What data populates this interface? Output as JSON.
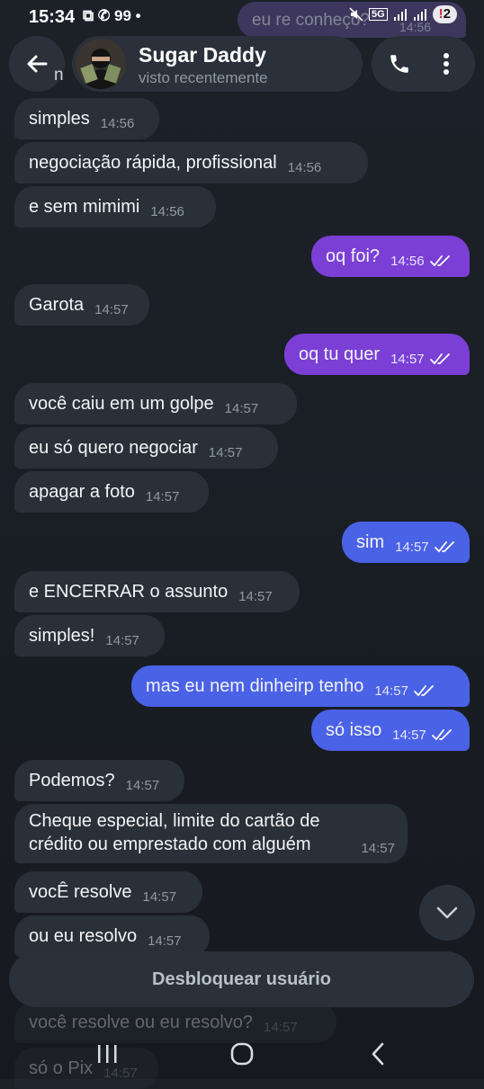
{
  "status_bar": {
    "time": "15:34",
    "left_icons": "⧉ ✆ 99 •",
    "network": "5G",
    "badge": "2"
  },
  "header": {
    "contact_name": "Sugar Daddy",
    "status": "visto recentemente",
    "peek_text": "n"
  },
  "top_partial": {
    "text": "eu re conheço?",
    "time": "14:56"
  },
  "messages": [
    {
      "dir": "in",
      "text": "simples",
      "time": "14:56"
    },
    {
      "dir": "in",
      "text": "negociação rápida, profissional",
      "time": "14:56"
    },
    {
      "dir": "in",
      "text": "e sem mimimi",
      "time": "14:56"
    },
    {
      "dir": "out",
      "text": "oq foi?",
      "time": "14:56"
    },
    {
      "dir": "in",
      "text": "Garota",
      "time": "14:57"
    },
    {
      "dir": "out",
      "text": "oq tu quer",
      "time": "14:57"
    },
    {
      "dir": "in",
      "text": "você caiu em um golpe",
      "time": "14:57"
    },
    {
      "dir": "in",
      "text": "eu só quero negociar",
      "time": "14:57"
    },
    {
      "dir": "in",
      "text": "apagar a foto",
      "time": "14:57"
    },
    {
      "dir": "out",
      "text": "sim",
      "time": "14:57"
    },
    {
      "dir": "in",
      "text": "e ENCERRAR o assunto",
      "time": "14:57"
    },
    {
      "dir": "in",
      "text": "simples!",
      "time": "14:57"
    },
    {
      "dir": "out",
      "text": "mas eu nem dinheirp tenho",
      "time": "14:57"
    },
    {
      "dir": "out",
      "text": "só isso",
      "time": "14:57"
    },
    {
      "dir": "in",
      "text": "Podemos?",
      "time": "14:57"
    },
    {
      "dir": "in",
      "text": "Cheque especial, limite do cartão de crédito ou emprestado com alguém",
      "time": "14:57"
    },
    {
      "dir": "in",
      "text": "vocÊ resolve",
      "time": "14:57"
    },
    {
      "dir": "in",
      "text": "ou eu resolvo",
      "time": "14:57"
    },
    {
      "dir": "in",
      "text": "você resolve ou eu resolvo?",
      "time": "14:57"
    },
    {
      "dir": "in",
      "text": "só o Pix",
      "time": "14:57"
    }
  ],
  "unblock_label": "Desbloquear usuário",
  "icons": {
    "back": "arrow-left-icon",
    "call": "phone-icon",
    "more": "more-vertical-icon",
    "scroll": "chevron-down-icon",
    "read": "double-check-icon"
  },
  "colors": {
    "bubble_in": "#2a3038",
    "bubble_out_purple": "#7b3fd6",
    "bubble_out_blue": "#4a62e6",
    "background": "#1a1f26"
  }
}
